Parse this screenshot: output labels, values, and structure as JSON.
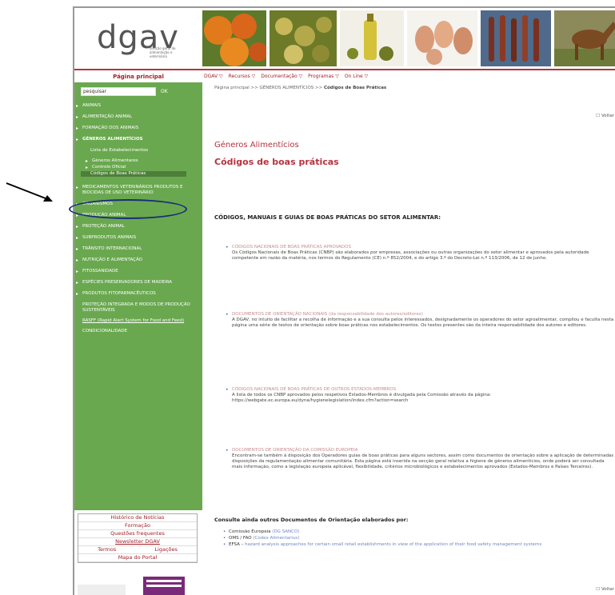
{
  "logo": {
    "text": "dgav",
    "subtitle": "direção geral de alimentação e veterinária"
  },
  "header_photos": [
    "pumpkins-photo",
    "hops-photo",
    "olive-oil-photo",
    "eggs-photo",
    "sausages-photo",
    "horse-photo"
  ],
  "home_link": "Página principal",
  "top_nav": [
    "DGAV ▽",
    "Recursos ▽",
    "Documentação ▽",
    "Programas ▽",
    "On Line ▽"
  ],
  "search": {
    "value": "pesquisar",
    "button": "OK"
  },
  "sidebar": {
    "items": [
      {
        "label": "ANIMAIS",
        "type": "main"
      },
      {
        "label": "ALIMENTAÇÃO ANIMAL",
        "type": "main"
      },
      {
        "label": "FORMAÇÃO DOS ANIMAIS",
        "type": "main"
      },
      {
        "label": "GÉNEROS ALIMENTÍCIOS",
        "type": "main-bold"
      },
      {
        "label": "Lista de Estabelecimentos",
        "type": "plain"
      },
      {
        "label": "Géneros Alimentares",
        "type": "sub"
      },
      {
        "label": "Controlo Oficial",
        "type": "sub"
      },
      {
        "label": "Códigos de Boas Práticas",
        "type": "selected"
      },
      {
        "label": "MEDICAMENTOS VETERINÁRIOS PRODUTOS E BIOCIDAS DE USO VETERINÁRIO",
        "type": "main"
      },
      {
        "label": "ORGANISMOS",
        "type": "main"
      },
      {
        "label": "PRODUÇÃO ANIMAL",
        "type": "main"
      },
      {
        "label": "PROTEÇÃO ANIMAL",
        "type": "main"
      },
      {
        "label": "SUBPRODUTOS ANIMAIS",
        "type": "main"
      },
      {
        "label": "TRÂNSITO INTERNACIONAL",
        "type": "main"
      },
      {
        "label": "NUTRIÇÃO E ALIMENTAÇÃO",
        "type": "main"
      },
      {
        "label": "FITOSSANIDADE",
        "type": "main"
      },
      {
        "label": "ESPÉCIES PRESERVADORES DE MADEIRA",
        "type": "main"
      },
      {
        "label": "PRODUTOS FITOFARMACÊUTICOS",
        "type": "main"
      },
      {
        "label": "PROTEÇÃO INTEGRADA E MODOS DE PRODUÇÃO SUSTENTÁVEIS",
        "type": "plain"
      },
      {
        "label": "RASFF (Rapid Alert System for Food and Feed)",
        "type": "plain-u"
      },
      {
        "label": "CONDICIONALIDADE",
        "type": "plain"
      }
    ]
  },
  "bottom_menu": {
    "news": "Histórico de Notícias",
    "training": "Formação",
    "faq": "Questões frequentes",
    "newsletter": "Newsletter DGAV",
    "terms": "Termos",
    "links": "Ligações",
    "sitemap": "Mapa do Portal"
  },
  "content": {
    "breadcrumb": {
      "home": "Página principal",
      "sep": ">>",
      "mid": "GÉNEROS ALIMENTÍCIOS",
      "current": "Códigos de Boas Práticas"
    },
    "voltar": "Voltar",
    "section": "Géneros Alimentícios",
    "title": "Códigos de boas práticas",
    "heading": "CÓDIGOS, MANUAIS E GUIAS DE BOAS PRÁTICAS DO SETOR ALIMENTAR:",
    "items": [
      {
        "title": "CÓDIGOS NACIONAIS DE BOAS PRÁTICAS APROVADOS",
        "text": "Os Códigos Nacionais de Boas Práticas (CNBP) são elaborados por empresas, associações ou outras organizações do setor alimentar e aprovados pela autoridade competente em razão da matéria, nos termos do Regulamento (CE) n.º 852/2004, e do artigo 3.º do Decreto-Lei n.º 113/2006, de 12 de junho."
      },
      {
        "title": "DOCUMENTOS DE ORIENTAÇÃO NACIONAIS (da responsabilidade dos autores/editores)",
        "text": "A DGAV, no intuito de facilitar a recolha de informação e a sua consulta pelos interessados, designadamente os operadores do setor agroalimentar, compilou e faculta nesta página uma série de textos de orientação sobre boas práticas nos estabelecimentos. Os textos presentes são da inteira responsabilidade dos autores e editores."
      },
      {
        "title": "CÓDIGOS NACIONAIS DE BOAS PRÁTICAS DE OUTROS ESTADOS-MEMBROS",
        "text": "A lista de todos os CNBP aprovados pelos respetivos Estados-Membros é divulgada pela Comissão através da página: https://webgate.ec.europa.eu/dyna/hygienelegislation/index.cfm?action=search"
      },
      {
        "title": "DOCUMENTOS DE ORIENTAÇÃO DA COMISSÃO EUROPEIA",
        "text": "Encontram-se também à disposição dos Operadores guias de boas práticas para alguns sectores, assim como documentos de orientação sobre a aplicação de determinadas disposições da regulamentação alimentar comunitária. Esta página está inserida na secção geral relativa a higiene de géneros alimentícios, onde poderá ser consultada mais informação, como a legislação europeia aplicável, flexibilidade, critérios microbiológicos e estabelecimentos aprovados (Estados-Membros e Países Terceiros)."
      }
    ],
    "consult_heading": "Consulte ainda outros Documentos de Orientação elaborados por:",
    "consult_items": [
      {
        "label": "Comissão Europeia",
        "link": "(DG SANCO)"
      },
      {
        "label": "OMS / FAO",
        "link": "(Codex Alimentarius)"
      },
      {
        "label": "EFSA –",
        "link": "hazard analysis approaches for certain small retail establishments in view of the application of their food safety management systems"
      }
    ]
  }
}
